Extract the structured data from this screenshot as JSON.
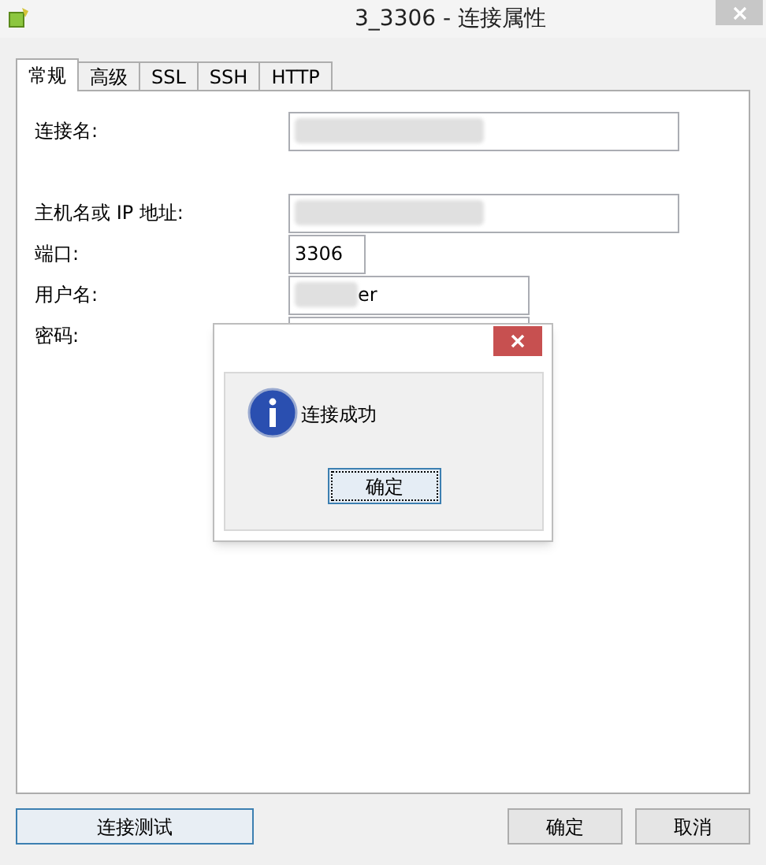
{
  "window": {
    "title": "3_3306 - 连接属性"
  },
  "tabs": [
    {
      "label": "常规",
      "selected": true
    },
    {
      "label": "高级",
      "selected": false
    },
    {
      "label": "SSL",
      "selected": false
    },
    {
      "label": "SSH",
      "selected": false
    },
    {
      "label": "HTTP",
      "selected": false
    }
  ],
  "fields": [
    {
      "label": "连接名:",
      "redacted": true
    },
    {
      "label": "主机名或 IP 地址:",
      "redacted": true
    },
    {
      "label": "端口:",
      "value": "3306"
    },
    {
      "label": "用户名:",
      "value": "er",
      "redacted": true
    },
    {
      "label": "密码:"
    }
  ],
  "message_box": {
    "message": "连接成功",
    "button": "确定"
  },
  "buttons": {
    "test": "连接测试",
    "ok": "确定",
    "cancel": "取消"
  }
}
